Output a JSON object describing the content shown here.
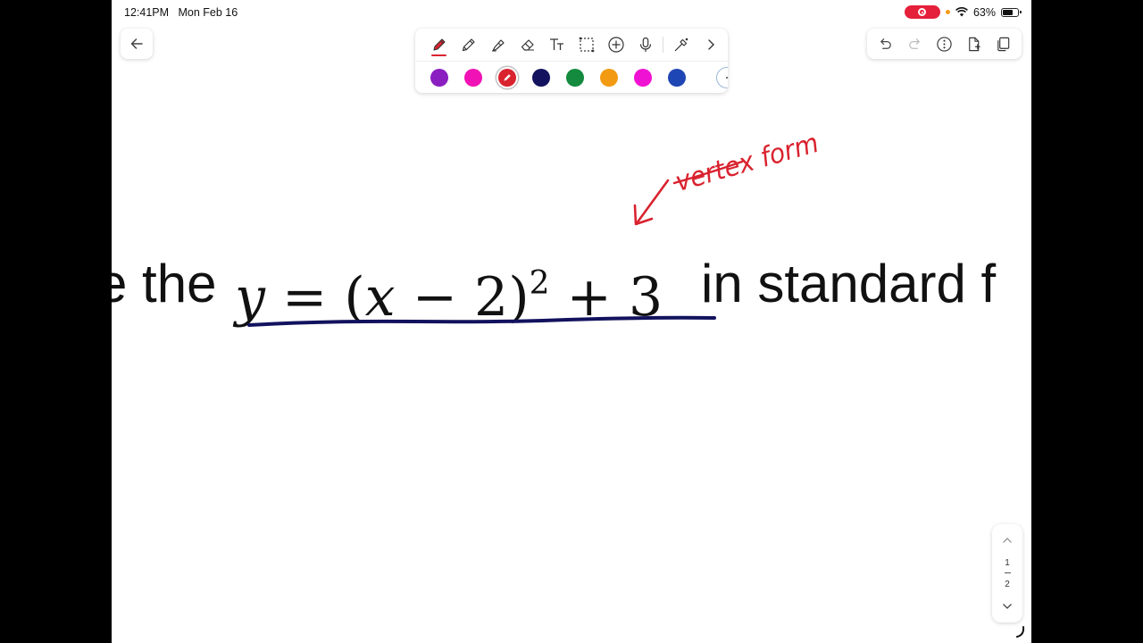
{
  "status_bar": {
    "time": "12:41PM",
    "date": "Mon Feb 16",
    "battery": "63%",
    "battery_level": 0.63,
    "recording": true
  },
  "toolbar": {
    "tools": [
      {
        "name": "pen-tool",
        "icon": "pen-icon",
        "active": true
      },
      {
        "name": "pencil-tool",
        "icon": "pencil-icon"
      },
      {
        "name": "highlighter-tool",
        "icon": "highlighter-icon"
      },
      {
        "name": "eraser-tool",
        "icon": "eraser-icon"
      },
      {
        "name": "text-tool",
        "icon": "text-icon",
        "label": "Tt"
      },
      {
        "name": "lasso-tool",
        "icon": "lasso-select-icon"
      },
      {
        "name": "add-tool",
        "icon": "plus-circle-icon"
      },
      {
        "name": "mic-tool",
        "icon": "microphone-icon"
      },
      {
        "name": "laser-tool",
        "icon": "laser-pointer-icon"
      },
      {
        "name": "more-tools",
        "icon": "chevron-right-icon"
      }
    ],
    "colors": [
      "#8a1ec0",
      "#f012b4",
      "#d9232f",
      "#12125e",
      "#138a3e",
      "#f29b12",
      "#f012d2",
      "#1e46b4"
    ],
    "selected_color": "#d9232f"
  },
  "right_tools": [
    "undo-icon",
    "redo-icon",
    "more-options-icon",
    "add-page-icon",
    "pages-icon"
  ],
  "annotation": {
    "text": "vertex form",
    "color": "#d9232f"
  },
  "equation": {
    "lead": "e the",
    "y": "y",
    "equals": "=",
    "open_paren": "(",
    "x": "x",
    "minus_two": "− 2",
    "close_paren": ")",
    "exponent": "2",
    "plus_three": "+ 3",
    "tail": "in standard f",
    "underline_color": "#12125e"
  },
  "page_nav": {
    "current": "1",
    "total": "2"
  }
}
